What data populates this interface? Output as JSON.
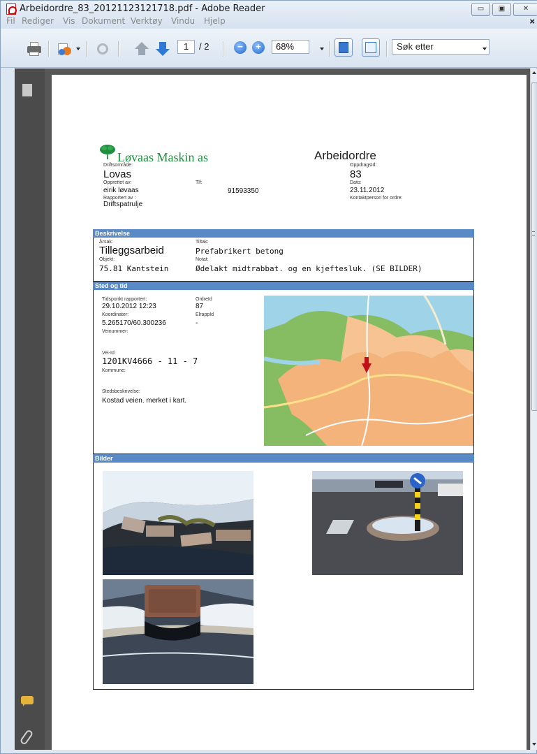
{
  "window": {
    "title": "Arbeidordre_83_20121123121718.pdf - Adobe Reader"
  },
  "menu": {
    "items": [
      "Fil",
      "Rediger",
      "Vis",
      "Dokument",
      "Verktøy",
      "Vindu",
      "Hjelp"
    ],
    "close_glyph": "×"
  },
  "toolbar": {
    "page_number": "1",
    "page_total": "/ 2",
    "zoom": "68%",
    "search_placeholder": "Søk etter",
    "zoom_out_glyph": "−",
    "zoom_in_glyph": "+"
  },
  "document": {
    "company": "Løvaas Maskin as",
    "title": "Arbeidordre",
    "header": {
      "driftsomrade_label": "Driftsområde:",
      "driftsomrade": "Lovas",
      "opprettet_label": "Opprettet av:",
      "opprettet": "eirik løvaas",
      "tlf_label": "Tlf:",
      "tlf": "91593350",
      "rapportert_label": "Rapportert av :",
      "rapportert": "Driftspatrulje",
      "oppdragsid_label": "OppdragsId:",
      "oppdragsid": "83",
      "dato_label": "Dato:",
      "dato": "23.11.2012",
      "kontakt_label": "Kontaktperson for ordre:"
    },
    "beskrivelse": {
      "heading": "Beskrivelse",
      "arsak_label": "Årsak:",
      "arsak": "Tilleggsarbeid",
      "tiltak_label": "Tiltak:",
      "tiltak": "Prefabrikert betong",
      "objekt_label": "Objekt:",
      "objekt": "75.81 Kantstein",
      "notat_label": "Notat:",
      "notat": "Ødelakt midtrabbat. og en kjeftesluk. (SE BILDER)"
    },
    "sted": {
      "heading": "Sted og tid",
      "tidspunkt_label": "Tidspunkt rapportert:",
      "tidspunkt": "29.10.2012 12:23",
      "ordreid_label": "OrdreId",
      "ordreid": "87",
      "koordinater_label": "Koordinater:",
      "koordinater": "5.265170/60.300236",
      "elrappid_label": "ElrappId",
      "elrappid": "-",
      "veinummer_label": "Veinummer:",
      "veiid_label": "Vei-Id",
      "veiid": "1201KV4666 - 11 - 7",
      "kommune_label": "Kommune:",
      "stedsbeskrivelse_label": "Stedsbeskrivelse:",
      "stedsbeskrivelse": "Kostad veien. merket i kart."
    },
    "bilder": {
      "heading": "Bilder"
    }
  },
  "icons": {
    "print": "printer-icon",
    "collaborate": "collaborate-icon",
    "hand": "hand-icon",
    "prev": "arrow-up-icon",
    "next": "arrow-down-icon",
    "fit_width": "fit-width-icon",
    "fit_page": "fit-page-icon"
  }
}
